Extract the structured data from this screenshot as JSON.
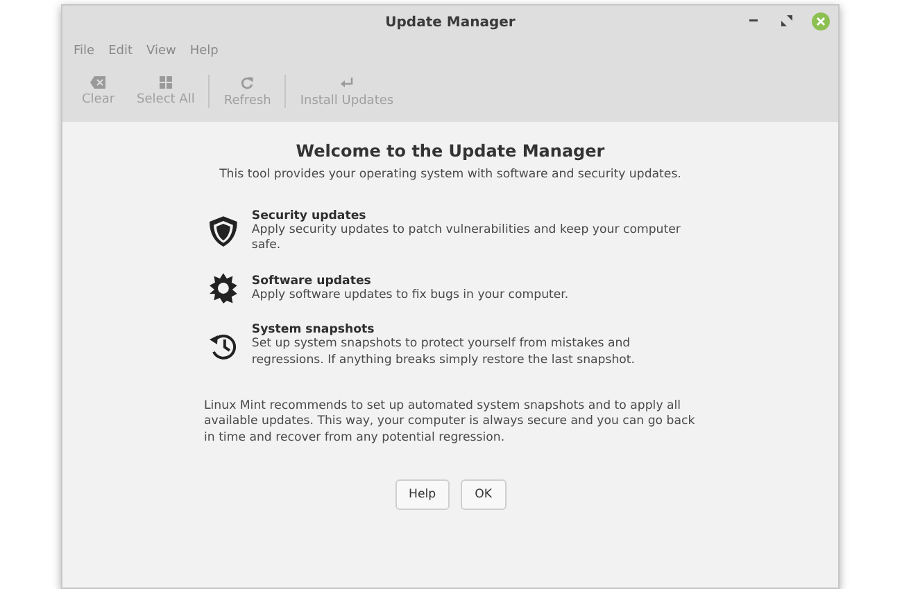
{
  "window": {
    "title": "Update Manager"
  },
  "menu": [
    "File",
    "Edit",
    "View",
    "Help"
  ],
  "toolbar": [
    {
      "label": "Clear",
      "kind": "clear",
      "disabled": true
    },
    {
      "label": "Select All",
      "kind": "select",
      "disabled": true
    },
    {
      "label": "Refresh",
      "kind": "refresh",
      "disabled": true
    },
    {
      "label": "Install Updates",
      "kind": "install",
      "disabled": true
    }
  ],
  "welcome": {
    "title": "Welcome to the Update Manager",
    "subtitle": "This tool provides your operating system with software and security updates."
  },
  "features": [
    {
      "kind": "shield",
      "title": "Security updates",
      "text": "Apply security updates to patch vulnerabilities and keep your computer safe."
    },
    {
      "kind": "gear",
      "title": "Software updates",
      "text": "Apply software updates to fix bugs in your computer."
    },
    {
      "kind": "history",
      "title": "System snapshots",
      "text": "Set up system snapshots to protect yourself from mistakes and regressions. If anything breaks simply restore the last snapshot."
    }
  ],
  "recommendation": "Linux Mint recommends to set up automated system snapshots and to apply all available updates. This way, your computer is always secure and you can go back in time and recover from any potential regression.",
  "buttons": [
    "Help",
    "OK"
  ]
}
